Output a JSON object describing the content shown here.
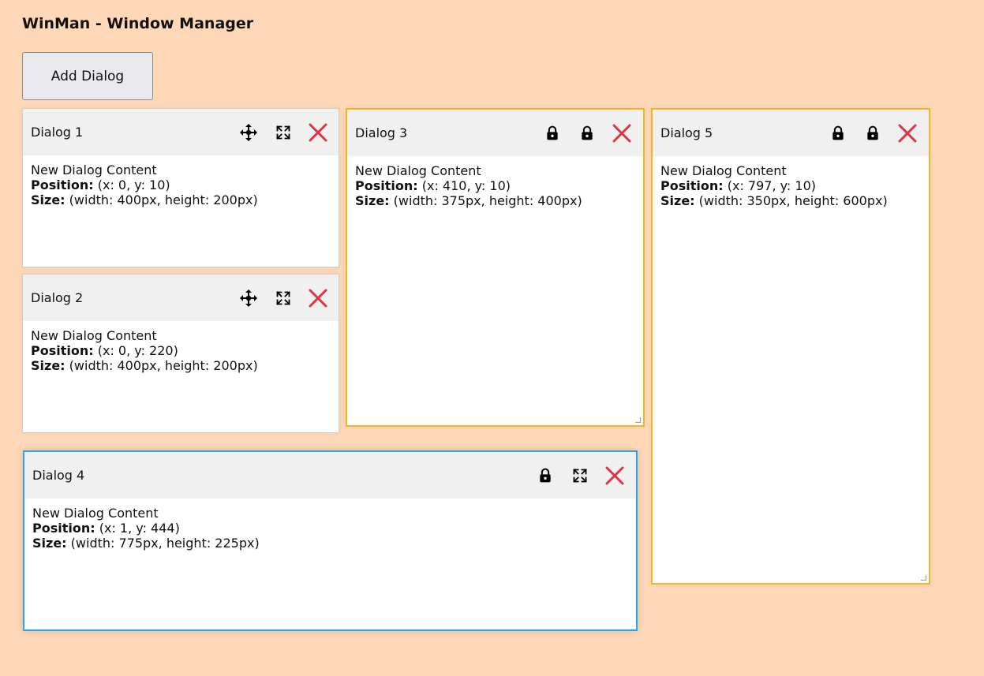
{
  "app": {
    "title": "WinMan - Window Manager",
    "add_button_label": "Add Dialog"
  },
  "colors": {
    "background": "#ffd9b7",
    "locked_border": "#f5b423",
    "active_border": "#28a7e6",
    "close": "#dc3545"
  },
  "dialogs": [
    {
      "title": "Dialog 1",
      "content": "New Dialog Content",
      "position_label": "Position:",
      "position_value": " (x: 0, y: 10)",
      "size_label": "Size:",
      "size_value": " (width: 400px, height: 200px)",
      "buttons": [
        "move-icon",
        "maximize-icon",
        "close-icon"
      ]
    },
    {
      "title": "Dialog 2",
      "content": "New Dialog Content",
      "position_label": "Position:",
      "position_value": " (x: 0, y: 220)",
      "size_label": "Size:",
      "size_value": " (width: 400px, height: 200px)",
      "buttons": [
        "move-icon",
        "maximize-icon",
        "close-icon"
      ]
    },
    {
      "title": "Dialog 3",
      "content": "New Dialog Content",
      "position_label": "Position:",
      "position_value": " (x: 410, y: 10)",
      "size_label": "Size:",
      "size_value": " (width: 375px, height: 400px)",
      "buttons": [
        "lock-icon",
        "lock-icon",
        "close-icon"
      ]
    },
    {
      "title": "Dialog 4",
      "content": "New Dialog Content",
      "position_label": "Position:",
      "position_value": " (x: 1, y: 444)",
      "size_label": "Size:",
      "size_value": " (width: 775px, height: 225px)",
      "buttons": [
        "lock-icon",
        "maximize-icon",
        "close-icon"
      ]
    },
    {
      "title": "Dialog 5",
      "content": "New Dialog Content",
      "position_label": "Position:",
      "position_value": " (x: 797, y: 10)",
      "size_label": "Size:",
      "size_value": " (width: 350px, height: 600px)",
      "buttons": [
        "lock-icon",
        "lock-icon",
        "close-icon"
      ]
    }
  ]
}
